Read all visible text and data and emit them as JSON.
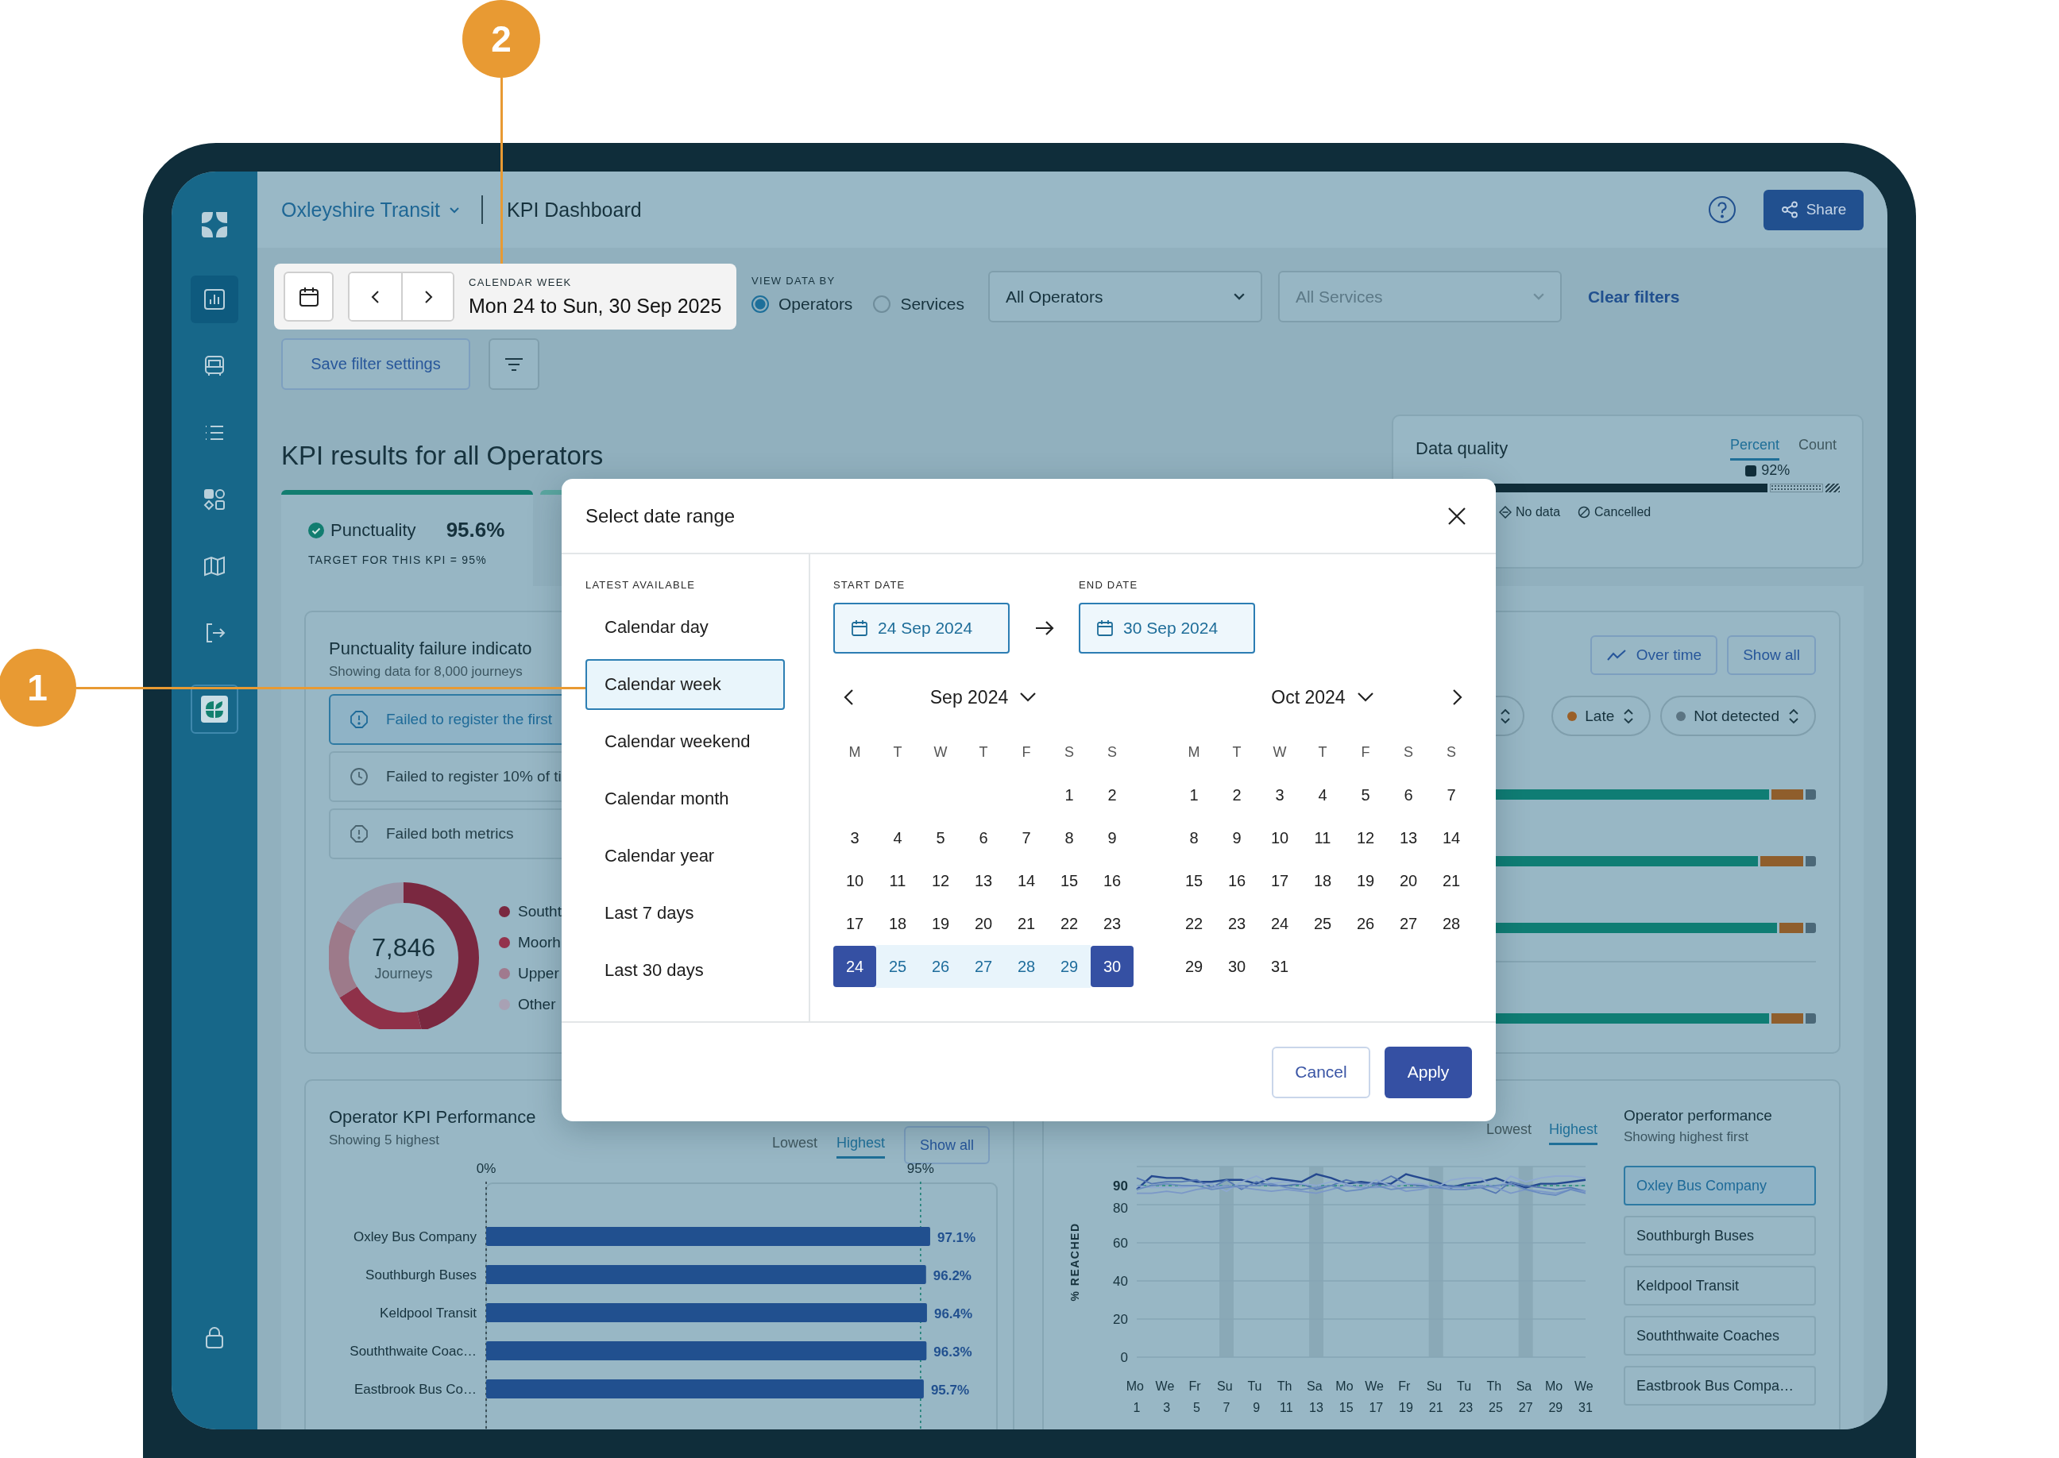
{
  "callouts": [
    {
      "label": "2"
    },
    {
      "label": "1"
    }
  ],
  "sidebar": {
    "items": [
      {
        "selected": true
      },
      {
        "selected": false
      },
      {
        "selected": false
      },
      {
        "selected": false
      },
      {
        "selected": false
      },
      {
        "selected": false
      }
    ]
  },
  "header": {
    "organization": "Oxleyshire Transit",
    "page_title": "KPI Dashboard",
    "share_button": "Share"
  },
  "filters": {
    "period_label": "CALENDAR WEEK",
    "period": "Mon 24 to Sun, 30 Sep 2025",
    "view_by_label": "VIEW DATA BY",
    "view_by": [
      {
        "label": "Operators",
        "selected": true
      },
      {
        "label": "Services",
        "selected": false
      }
    ],
    "selects": [
      {
        "value": "All Operators"
      },
      {
        "placeholder": "All Services"
      }
    ],
    "clear_filters": "Clear filters",
    "save_button": "Save filter settings"
  },
  "kpi": {
    "title": "KPI results for all Operators",
    "tabs": [
      {
        "name": "Punctuality",
        "value": "95.6%",
        "target": "TARGET FOR THIS KPI = 95%",
        "selected": true
      },
      {
        "selected": false
      }
    ]
  },
  "data_quality": {
    "title": "Data quality",
    "tabs": [
      {
        "label": "Percent",
        "selected": true
      },
      {
        "label": "Count",
        "selected": false
      }
    ],
    "reading": "92%",
    "level": 0.83,
    "legend": [
      "No data",
      "Cancelled"
    ]
  },
  "failure_indicators": {
    "title": "Punctuality failure indicato",
    "subtitle": "Showing data for 8,000 journeys",
    "items": [
      {
        "label": "Failed to register the first",
        "selected": true
      },
      {
        "label": "Failed to register 10% of ti",
        "selected": false
      },
      {
        "label": "Failed both metrics",
        "selected": false
      }
    ],
    "donut": {
      "total": "7,846",
      "unit": "Journeys",
      "legend": [
        {
          "label": "Southt",
          "color": "#7a2840"
        },
        {
          "label": "Moorh",
          "color": "#93334d"
        },
        {
          "label": "Upper",
          "color": "#a07a8e"
        },
        {
          "label": "Other",
          "color": "#a8a1b4"
        }
      ]
    },
    "buttons": [
      "Over time",
      "Show all"
    ],
    "chips": [
      {
        "label": "Late",
        "color": "#9a5f27"
      },
      {
        "label": "Not detected",
        "color": "#5b7482"
      }
    ]
  },
  "operator_kpi": {
    "title": "Operator KPI Performance",
    "subtitle": "Showing 5 highest",
    "sort_tabs": [
      {
        "label": "Lowest",
        "selected": false
      },
      {
        "label": "Highest",
        "selected": true
      }
    ],
    "show_all": "Show all",
    "chart_data": {
      "type": "bar",
      "orientation": "horizontal",
      "categories": [
        "Oxley Bus Company",
        "Southburgh Buses",
        "Keldpool Transit",
        "Souththwaite Coac…",
        "Eastbrook Bus Co…"
      ],
      "values": [
        97.1,
        96.2,
        96.4,
        96.3,
        95.7
      ],
      "xlim": [
        0,
        111.7
      ],
      "xticks": [
        {
          "value": 0,
          "label": "0%"
        },
        {
          "value": 95,
          "label": "95%"
        }
      ],
      "ref_lines": [
        {
          "axis": "x",
          "value": 95
        }
      ],
      "value_labels": [
        "97.1%",
        "96.2%",
        "96.4%",
        "96.3%",
        "95.7%"
      ]
    }
  },
  "operator_trend": {
    "sort_tabs": [
      {
        "label": "Lowest",
        "selected": false
      },
      {
        "label": "Highest",
        "selected": true
      }
    ],
    "chart_data": {
      "type": "line",
      "ylabel": "% REACHED",
      "categories": [
        "Mo 1",
        null,
        "We 3",
        null,
        "Fr 5",
        null,
        "Su 7",
        null,
        "Tu 9",
        null,
        "Th 11",
        null,
        "Sa 13",
        null,
        "Mo 15",
        null,
        "We 17",
        null,
        "Fr 19",
        null,
        "Su 21",
        null,
        "Tu 23",
        null,
        "Th 25",
        null,
        "Sa 27",
        null,
        "Mo 29",
        null,
        "We 31"
      ],
      "ylim": [
        0,
        100
      ],
      "yticks": [
        0,
        20,
        40,
        60,
        80,
        90
      ],
      "series": [
        {
          "color": "#24488f",
          "values": [
            88,
            95,
            94,
            94,
            92,
            92,
            93,
            93,
            91,
            94,
            93,
            92,
            96,
            94,
            91,
            92,
            91,
            91,
            96,
            94,
            92,
            89,
            91,
            92,
            94,
            91,
            89,
            91,
            91,
            92,
            93
          ]
        },
        {
          "color": "#5577b3",
          "values": [
            94,
            91,
            92,
            92,
            93,
            89,
            93,
            88,
            92,
            90,
            90,
            91,
            88,
            90,
            93,
            91,
            91,
            95,
            91,
            90,
            89,
            90,
            89,
            89,
            86,
            92,
            90,
            89,
            88,
            89,
            87
          ]
        },
        {
          "color": "#8ea9d1",
          "values": [
            90,
            89,
            89,
            89,
            90,
            91,
            87,
            92,
            95,
            91,
            92,
            91,
            90,
            92,
            91,
            88,
            93,
            90,
            91,
            91,
            89,
            93,
            94,
            94,
            88,
            95,
            92,
            94,
            95,
            95,
            94
          ]
        },
        {
          "color": "#7b98c8",
          "values": [
            86,
            86,
            87,
            86,
            88,
            89,
            90,
            89,
            88,
            87,
            88,
            87,
            86,
            88,
            90,
            89,
            89,
            90,
            87,
            88,
            90,
            89,
            89,
            90,
            89,
            86,
            88,
            87,
            86,
            88,
            87
          ]
        },
        {
          "color": "#6a8cc0",
          "values": [
            88,
            90,
            91,
            90,
            90,
            88,
            89,
            90,
            90,
            91,
            89,
            88,
            89,
            90,
            87,
            88,
            90,
            88,
            89,
            89,
            89,
            88,
            88,
            89,
            90,
            91,
            88,
            86,
            85,
            88,
            86
          ]
        }
      ],
      "grid": true,
      "ref_lines": [
        {
          "axis": "y",
          "value": 90
        }
      ],
      "bands": [
        {
          "axis": "x",
          "from": "Su 7",
          "to": "Su 7"
        },
        {
          "axis": "x",
          "from": "Sa 13",
          "to": "Sa 13"
        },
        {
          "axis": "x",
          "from": "Su 21",
          "to": "Su 21"
        },
        {
          "axis": "x",
          "from": "Sa 27",
          "to": "Sa 27"
        }
      ]
    },
    "list_title": "Operator performance",
    "list_subtitle": "Showing highest first",
    "operators": [
      {
        "label": "Oxley Bus Company",
        "selected": true
      },
      {
        "label": "Southburgh Buses",
        "selected": false
      },
      {
        "label": "Keldpool Transit",
        "selected": false
      },
      {
        "label": "Souththwaite Coaches",
        "selected": false
      },
      {
        "label": "Eastbrook Bus Compa…",
        "selected": false
      }
    ]
  },
  "modal": {
    "title": "Select date range",
    "presets_label": "LATEST AVAILABLE",
    "presets": [
      {
        "label": "Calendar day",
        "selected": false
      },
      {
        "label": "Calendar week",
        "selected": true
      },
      {
        "label": "Calendar weekend",
        "selected": false
      },
      {
        "label": "Calendar month",
        "selected": false
      },
      {
        "label": "Calendar year",
        "selected": false
      },
      {
        "label": "Last 7 days",
        "selected": false
      },
      {
        "label": "Last 30 days",
        "selected": false
      }
    ],
    "start_label": "START DATE",
    "start": "24 Sep 2024",
    "end_label": "END DATE",
    "end": "30 Sep 2024",
    "months": [
      {
        "title": "Sep 2024",
        "weekdays": [
          "M",
          "T",
          "W",
          "T",
          "F",
          "S",
          "S"
        ],
        "weeks": [
          [
            {
              "day": "1",
              "selected": false,
              "in_range": false
            },
            {
              "day": "2",
              "selected": false,
              "in_range": false
            }
          ],
          [
            {
              "day": "3",
              "selected": false,
              "in_range": false
            },
            {
              "day": "4",
              "selected": false,
              "in_range": false
            },
            {
              "day": "5",
              "selected": false,
              "in_range": false
            },
            {
              "day": "6",
              "selected": false,
              "in_range": false
            },
            {
              "day": "7",
              "selected": false,
              "in_range": false
            },
            {
              "day": "8",
              "selected": false,
              "in_range": false
            },
            {
              "day": "9",
              "selected": false,
              "in_range": false
            }
          ],
          [
            {
              "day": "10",
              "selected": false,
              "in_range": false
            },
            {
              "day": "11",
              "selected": false,
              "in_range": false
            },
            {
              "day": "12",
              "selected": false,
              "in_range": false
            },
            {
              "day": "13",
              "selected": false,
              "in_range": false
            },
            {
              "day": "14",
              "selected": false,
              "in_range": false
            },
            {
              "day": "15",
              "selected": false,
              "in_range": false
            },
            {
              "day": "16",
              "selected": false,
              "in_range": false
            }
          ],
          [
            {
              "day": "17",
              "selected": false,
              "in_range": false
            },
            {
              "day": "18",
              "selected": false,
              "in_range": false
            },
            {
              "day": "19",
              "selected": false,
              "in_range": false
            },
            {
              "day": "20",
              "selected": false,
              "in_range": false
            },
            {
              "day": "21",
              "selected": false,
              "in_range": false
            },
            {
              "day": "22",
              "selected": false,
              "in_range": false
            },
            {
              "day": "23",
              "selected": false,
              "in_range": false
            }
          ],
          [
            {
              "day": "24",
              "selected": true,
              "in_range": false
            },
            {
              "day": "25",
              "selected": false,
              "in_range": true
            },
            {
              "day": "26",
              "selected": false,
              "in_range": true
            },
            {
              "day": "27",
              "selected": false,
              "in_range": true
            },
            {
              "day": "28",
              "selected": false,
              "in_range": true
            },
            {
              "day": "29",
              "selected": false,
              "in_range": true
            },
            {
              "day": "30",
              "selected": true,
              "in_range": false
            }
          ]
        ]
      },
      {
        "title": "Oct 2024",
        "weekdays": [
          "M",
          "T",
          "W",
          "T",
          "F",
          "S",
          "S"
        ],
        "weeks": [
          [
            {
              "day": "1",
              "selected": false,
              "in_range": false
            },
            {
              "day": "2",
              "selected": false,
              "in_range": false
            },
            {
              "day": "3",
              "selected": false,
              "in_range": false
            },
            {
              "day": "4",
              "selected": false,
              "in_range": false
            },
            {
              "day": "5",
              "selected": false,
              "in_range": false
            },
            {
              "day": "6",
              "selected": false,
              "in_range": false
            },
            {
              "day": "7",
              "selected": false,
              "in_range": false
            }
          ],
          [
            {
              "day": "8",
              "selected": false,
              "in_range": false
            },
            {
              "day": "9",
              "selected": false,
              "in_range": false
            },
            {
              "day": "10",
              "selected": false,
              "in_range": false
            },
            {
              "day": "11",
              "selected": false,
              "in_range": false
            },
            {
              "day": "12",
              "selected": false,
              "in_range": false
            },
            {
              "day": "13",
              "selected": false,
              "in_range": false
            },
            {
              "day": "14",
              "selected": false,
              "in_range": false
            }
          ],
          [
            {
              "day": "15",
              "selected": false,
              "in_range": false
            },
            {
              "day": "16",
              "selected": false,
              "in_range": false
            },
            {
              "day": "17",
              "selected": false,
              "in_range": false
            },
            {
              "day": "18",
              "selected": false,
              "in_range": false
            },
            {
              "day": "19",
              "selected": false,
              "in_range": false
            },
            {
              "day": "20",
              "selected": false,
              "in_range": false
            },
            {
              "day": "21",
              "selected": false,
              "in_range": false
            }
          ],
          [
            {
              "day": "22",
              "selected": false,
              "in_range": false
            },
            {
              "day": "23",
              "selected": false,
              "in_range": false
            },
            {
              "day": "24",
              "selected": false,
              "in_range": false
            },
            {
              "day": "25",
              "selected": false,
              "in_range": false
            },
            {
              "day": "26",
              "selected": false,
              "in_range": false
            },
            {
              "day": "27",
              "selected": false,
              "in_range": false
            },
            {
              "day": "28",
              "selected": false,
              "in_range": false
            }
          ],
          [
            {
              "day": "29",
              "selected": false,
              "in_range": false
            },
            {
              "day": "30",
              "selected": false,
              "in_range": false
            },
            {
              "day": "31",
              "selected": false,
              "in_range": false
            }
          ]
        ]
      }
    ],
    "cancel": "Cancel",
    "apply": "Apply"
  }
}
